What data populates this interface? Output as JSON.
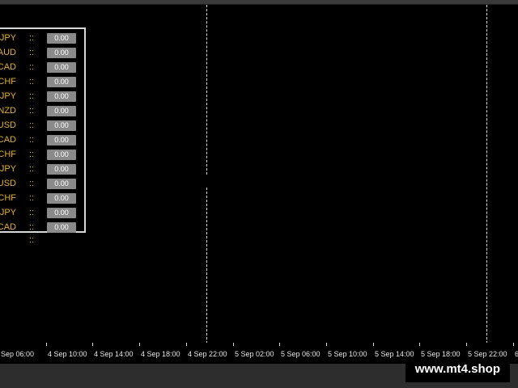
{
  "panel": {
    "rows": [
      {
        "pair": "JPY",
        "sep": "::",
        "value": "0.00"
      },
      {
        "pair": "AUD",
        "sep": "::",
        "value": "0.00"
      },
      {
        "pair": "CAD",
        "sep": "::",
        "value": "0.00"
      },
      {
        "pair": "CHF",
        "sep": "::",
        "value": "0.00"
      },
      {
        "pair": "JPY",
        "sep": "::",
        "value": "0.00"
      },
      {
        "pair": "NZD",
        "sep": "::",
        "value": "0.00"
      },
      {
        "pair": "USD",
        "sep": "::",
        "value": "0.00"
      },
      {
        "pair": "CAD",
        "sep": "::",
        "value": "0.00"
      },
      {
        "pair": "CHF",
        "sep": "::",
        "value": "0.00"
      },
      {
        "pair": "JPY",
        "sep": "::",
        "value": "0.00"
      },
      {
        "pair": "USD",
        "sep": "::",
        "value": "0.00"
      },
      {
        "pair": "CHF",
        "sep": "::",
        "value": "0.00"
      },
      {
        "pair": "JPY",
        "sep": "::",
        "value": "0.00"
      },
      {
        "pair": "CAD",
        "sep": "::",
        "value": "0.00"
      }
    ],
    "extra_sep": "::"
  },
  "time_axis": {
    "labels": [
      "Sep 06:00",
      "4 Sep 10:00",
      "4 Sep 14:00",
      "4 Sep 18:00",
      "4 Sep 22:00",
      "5 Sep 02:00",
      "5 Sep 06:00",
      "5 Sep 10:00",
      "5 Sep 14:00",
      "5 Sep 18:00",
      "5 Sep 22:00",
      "6 S"
    ]
  },
  "watermark": "www.mt4.shop",
  "colors": {
    "background": "#000000",
    "pair_text": "#e8b400",
    "value_box": "#8a8a8a",
    "grid_line": "#d8d8d8"
  }
}
